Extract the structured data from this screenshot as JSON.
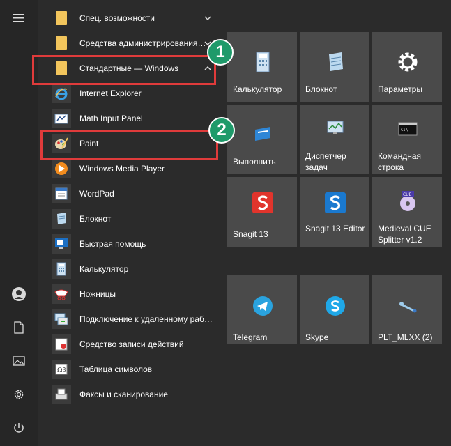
{
  "list": [
    {
      "label": "Спец. возможности",
      "icon": "folder-icon",
      "type": "folder",
      "chevron": "down"
    },
    {
      "label": "Средства администрирования…",
      "icon": "folder-icon",
      "type": "folder",
      "chevron": "down"
    },
    {
      "label": "Стандартные — Windows",
      "icon": "folder-icon",
      "type": "folder",
      "chevron": "up"
    },
    {
      "label": "Internet Explorer",
      "icon": "internet-explorer-icon",
      "type": "app"
    },
    {
      "label": "Math Input Panel",
      "icon": "math-input-panel-icon",
      "type": "app"
    },
    {
      "label": "Paint",
      "icon": "paint-icon",
      "type": "app"
    },
    {
      "label": "Windows Media Player",
      "icon": "media-player-icon",
      "type": "app"
    },
    {
      "label": "WordPad",
      "icon": "wordpad-icon",
      "type": "app"
    },
    {
      "label": "Блокнот",
      "icon": "notepad-icon",
      "type": "app"
    },
    {
      "label": "Быстрая помощь",
      "icon": "quick-assist-icon",
      "type": "app"
    },
    {
      "label": "Калькулятор",
      "icon": "calculator-icon",
      "type": "app"
    },
    {
      "label": "Ножницы",
      "icon": "snipping-tool-icon",
      "type": "app"
    },
    {
      "label": "Подключение к удаленному раб…",
      "icon": "remote-desktop-icon",
      "type": "app"
    },
    {
      "label": "Средство записи действий",
      "icon": "steps-recorder-icon",
      "type": "app"
    },
    {
      "label": "Таблица символов",
      "icon": "character-map-icon",
      "type": "app"
    },
    {
      "label": "Факсы и сканирование",
      "icon": "fax-scan-icon",
      "type": "app"
    }
  ],
  "tiles": [
    {
      "label": "Калькулятор",
      "icon": "calculator-icon"
    },
    {
      "label": "Блокнот",
      "icon": "notepad-icon"
    },
    {
      "label": "Параметры",
      "icon": "gear-icon"
    },
    {
      "label": "Выполнить",
      "icon": "run-icon"
    },
    {
      "label": "Диспетчер задач",
      "icon": "task-manager-icon"
    },
    {
      "label": "Командная строка",
      "icon": "command-prompt-icon"
    },
    {
      "label": "Snagit 13",
      "icon": "snagit-icon"
    },
    {
      "label": "Snagit 13 Editor",
      "icon": "snagit-editor-icon"
    },
    {
      "label": "Medieval CUE Splitter v1.2",
      "icon": "cue-splitter-icon"
    },
    {
      "label": "Telegram",
      "icon": "telegram-icon"
    },
    {
      "label": "Skype",
      "icon": "skype-icon"
    },
    {
      "label": "PLT_MLXX (2)",
      "icon": "headset-icon"
    }
  ],
  "rail": [
    {
      "icon": "hamburger-menu-icon"
    },
    {
      "icon": "user-avatar-icon"
    },
    {
      "icon": "documents-icon"
    },
    {
      "icon": "pictures-icon"
    },
    {
      "icon": "settings-gear-icon"
    },
    {
      "icon": "power-icon"
    }
  ],
  "annotations": [
    {
      "number": "1",
      "target": "Стандартные — Windows"
    },
    {
      "number": "2",
      "target": "Paint"
    }
  ],
  "colors": {
    "background": "#2b2b2b",
    "tile": "#4a4a4a",
    "folder": "#f2c55c",
    "highlight": "#e03b3b",
    "badge": "#1e9a6a"
  }
}
